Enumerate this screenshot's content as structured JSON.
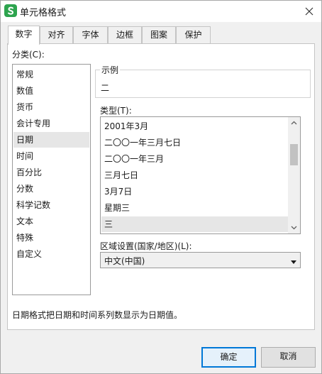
{
  "window": {
    "title": "单元格格式",
    "icon": "wps-spreadsheet-icon",
    "close_icon": "close-icon"
  },
  "tabs": [
    {
      "label": "数字",
      "active": true
    },
    {
      "label": "对齐",
      "active": false
    },
    {
      "label": "字体",
      "active": false
    },
    {
      "label": "边框",
      "active": false
    },
    {
      "label": "图案",
      "active": false
    },
    {
      "label": "保护",
      "active": false
    }
  ],
  "category": {
    "label": "分类(C):",
    "items": [
      "常规",
      "数值",
      "货币",
      "会计专用",
      "日期",
      "时间",
      "百分比",
      "分数",
      "科学记数",
      "文本",
      "特殊",
      "自定义"
    ],
    "selected": "日期"
  },
  "sample": {
    "label": "示例",
    "value": "二"
  },
  "type": {
    "label": "类型(T):",
    "items": [
      "2001年3月",
      "二〇〇一年三月七日",
      "二〇〇一年三月",
      "三月七日",
      "3月7日",
      "星期三",
      "三"
    ],
    "selected": "三"
  },
  "locale": {
    "label": "区域设置(国家/地区)(L):",
    "value": "中文(中国)"
  },
  "description": "日期格式把日期和时间系列数显示为日期值。",
  "buttons": {
    "ok": "确定",
    "cancel": "取消"
  },
  "colors": {
    "accent": "#0078d7",
    "selection": "#e6e6e6",
    "brand": "#2da44e"
  }
}
